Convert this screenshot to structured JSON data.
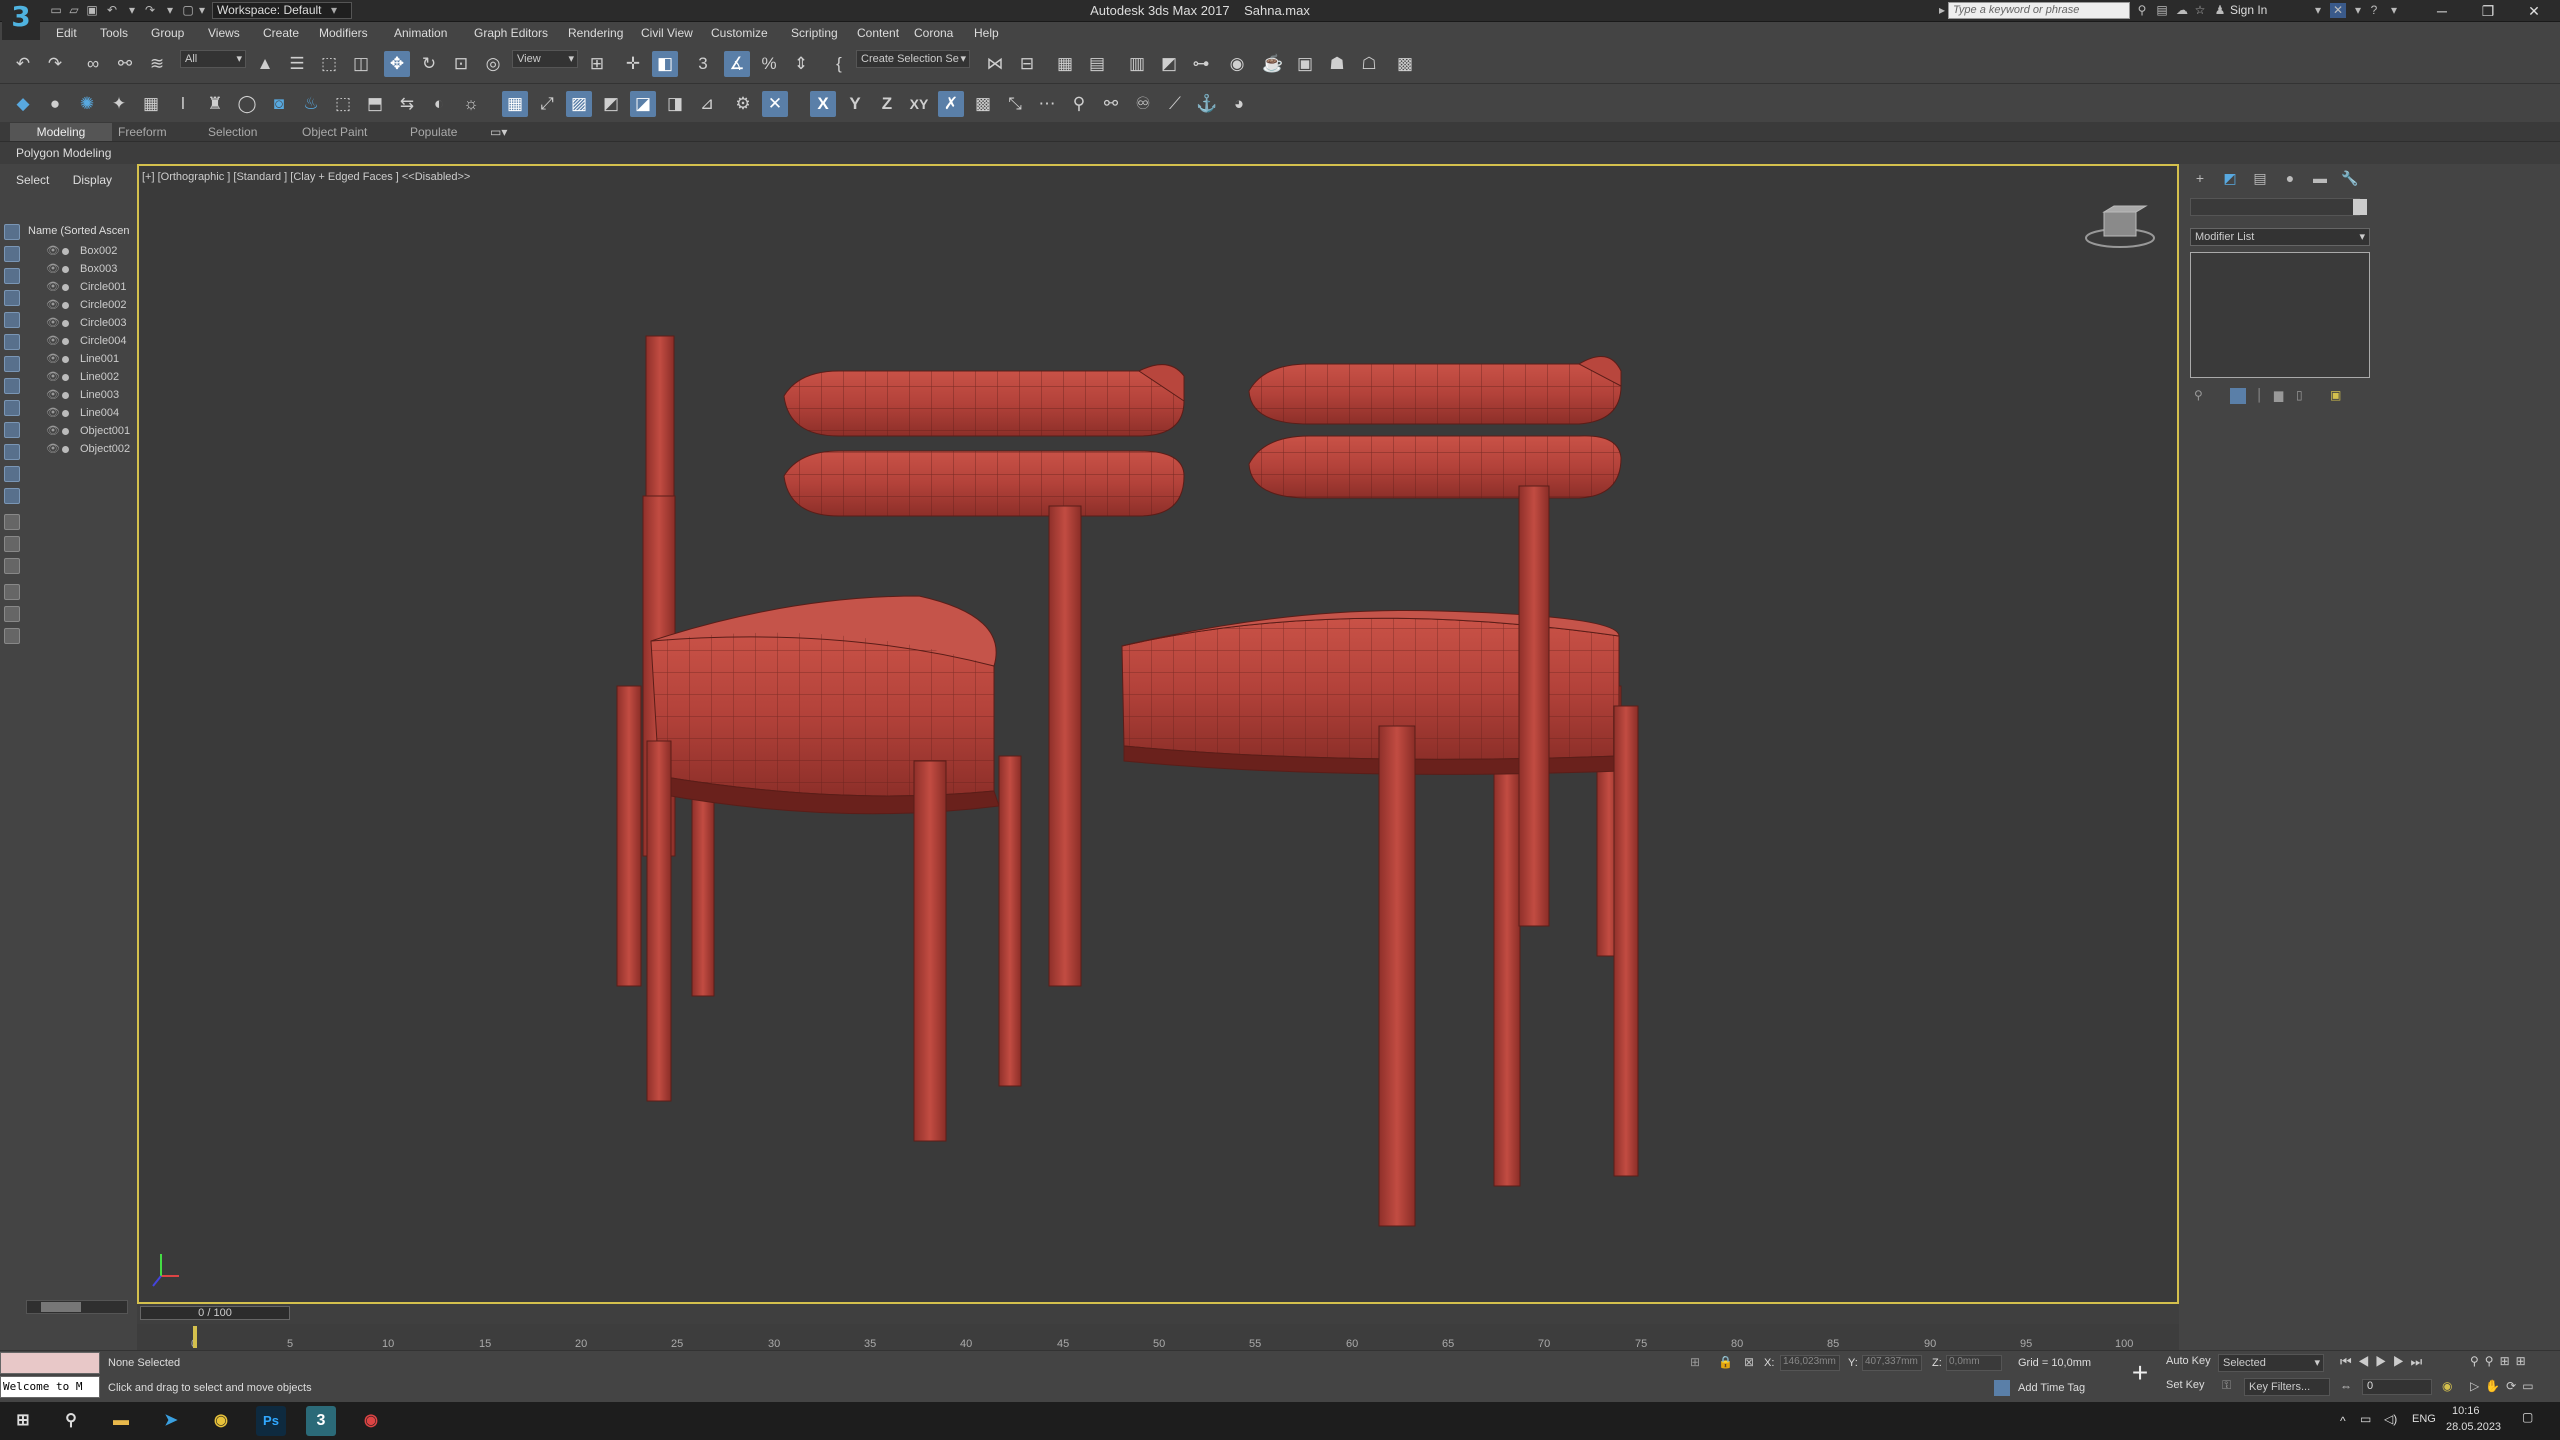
{
  "app": {
    "title": "Autodesk 3ds Max 2017",
    "filename": "Sahna.max",
    "workspace": "Workspace: Default",
    "search_placeholder": "Type a keyword or phrase",
    "sign_in": "Sign In"
  },
  "menus": [
    "Edit",
    "Tools",
    "Group",
    "Views",
    "Create",
    "Modifiers",
    "Animation",
    "Graph Editors",
    "Rendering",
    "Civil View",
    "Customize",
    "Scripting",
    "Content",
    "Corona",
    "Help"
  ],
  "toolbar": {
    "selection_filter": "All",
    "ref_coord": "View",
    "named_selection": "Create Selection Se"
  },
  "constraints": [
    "X",
    "Y",
    "Z",
    "XY"
  ],
  "ribbon": {
    "tabs": [
      "Modeling",
      "Freeform",
      "Selection",
      "Object Paint",
      "Populate"
    ],
    "panel": "Polygon Modeling"
  },
  "scene_explorer": {
    "tabs": [
      "Select",
      "Display"
    ],
    "header": "Name (Sorted Ascen",
    "objects": [
      "Box002",
      "Box003",
      "Circle001",
      "Circle002",
      "Circle003",
      "Circle004",
      "Line001",
      "Line002",
      "Line003",
      "Line004",
      "Object001",
      "Object002"
    ]
  },
  "viewport": {
    "label": "[+] [Orthographic ] [Standard ] [Clay + Edged Faces ]  <<Disabled>>",
    "mesh_color": "#b3423a",
    "background": "#3a3a3a",
    "border": "#d4c04d"
  },
  "command_panel": {
    "modifier_list": "Modifier List"
  },
  "timeline": {
    "slider": "0 / 100",
    "ticks": [
      "0",
      "5",
      "10",
      "15",
      "20",
      "25",
      "30",
      "35",
      "40",
      "45",
      "50",
      "55",
      "60",
      "65",
      "70",
      "75",
      "80",
      "85",
      "90",
      "95",
      "100"
    ]
  },
  "status": {
    "selection": "None Selected",
    "prompt": "Click and drag to select and move objects",
    "welcome": "Welcome to M",
    "x_label": "X:",
    "x_value": "146,023mm",
    "y_label": "Y:",
    "y_value": "407,337mm",
    "z_label": "Z:",
    "z_value": "0,0mm",
    "grid": "Grid = 10,0mm",
    "add_time_tag": "Add Time Tag",
    "auto_key": "Auto Key",
    "set_key": "Set Key",
    "selected_dd": "Selected",
    "key_filters": "Key Filters...",
    "frame": "0"
  },
  "taskbar": {
    "lang": "ENG",
    "time": "10:16",
    "date": "28.05.2023"
  }
}
